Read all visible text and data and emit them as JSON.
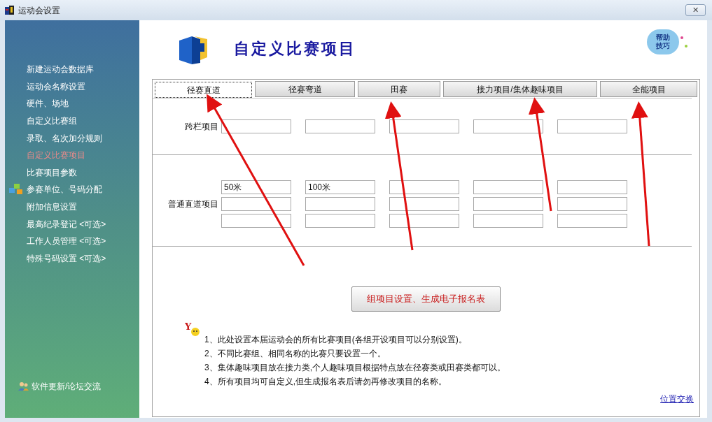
{
  "window": {
    "title": "运动会设置",
    "close_label": "✕"
  },
  "sidebar": {
    "items": [
      {
        "label": "新建运动会数据库",
        "selected": false,
        "kind": "plain"
      },
      {
        "label": "运动会名称设置",
        "selected": false,
        "kind": "plain"
      },
      {
        "label": "硬件、场地",
        "selected": false,
        "kind": "plain"
      },
      {
        "label": "自定义比赛组",
        "selected": false,
        "kind": "plain"
      },
      {
        "label": "录取、名次加分规则",
        "selected": false,
        "kind": "plain"
      },
      {
        "label": "自定义比赛项目",
        "selected": true,
        "kind": "plain"
      },
      {
        "label": "比赛项目参数",
        "selected": false,
        "kind": "plain"
      },
      {
        "label": "参赛单位、号码分配",
        "selected": false,
        "kind": "icon"
      },
      {
        "label": "附加信息设置",
        "selected": false,
        "kind": "plain"
      },
      {
        "label": "最高纪录登记 <可选>",
        "selected": false,
        "kind": "plain"
      },
      {
        "label": "工作人员管理 <可选>",
        "selected": false,
        "kind": "plain"
      },
      {
        "label": "特殊号码设置 <可选>",
        "selected": false,
        "kind": "plain"
      }
    ],
    "footer_link": "软件更新/论坛交流"
  },
  "header": {
    "title": "自定义比赛项目",
    "help_badge": [
      "帮助",
      "技巧"
    ]
  },
  "tabs": [
    {
      "label": "径赛直道",
      "selected": true
    },
    {
      "label": "径赛弯道",
      "selected": false
    },
    {
      "label": "田赛",
      "selected": false
    },
    {
      "label": "接力项目/集体趣味项目",
      "selected": false
    },
    {
      "label": "全能项目",
      "selected": false
    }
  ],
  "sections": [
    {
      "label": "跨栏项目",
      "rows": [
        [
          null,
          null,
          null,
          null,
          null
        ]
      ]
    },
    {
      "label": "普通直道项目",
      "rows": [
        [
          "50米",
          "100米",
          null,
          null,
          null
        ],
        [
          null,
          null,
          null,
          null,
          null
        ],
        [
          null,
          null,
          null,
          null,
          null
        ]
      ]
    }
  ],
  "action_button": "组项目设置、生成电子报名表",
  "notes": [
    "1、此处设置本届运动会的所有比赛项目(各组开设项目可以分别设置)。",
    "2、不同比赛组、相同名称的比赛只要设置一个。",
    "3、集体趣味项目放在接力类,个人趣味项目根据特点放在径赛类或田赛类都可以。",
    "4、所有项目均可自定义,但生成报名表后请勿再修改项目的名称。"
  ],
  "swap_link": "位置交换",
  "tip_mark": "Y"
}
